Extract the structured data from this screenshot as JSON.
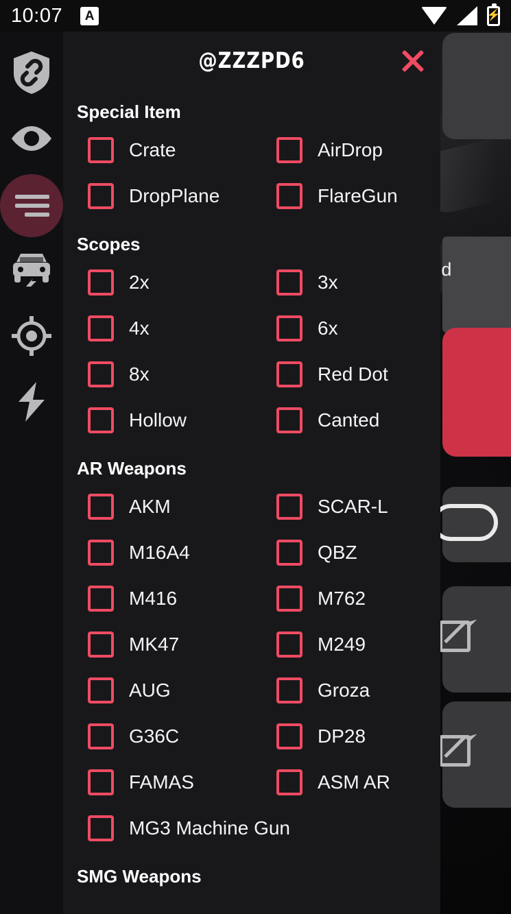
{
  "status_bar": {
    "time": "10:07",
    "app_badge": "A",
    "icons": [
      "wifi-icon",
      "signal-icon",
      "battery-charging-icon"
    ]
  },
  "background_app": {
    "partial_label": "nd",
    "icons": [
      "toggle-switch",
      "external-link-icon",
      "external-link-icon"
    ],
    "accent_color": "#cd3247"
  },
  "sidebar": {
    "items": [
      {
        "icon": "shield-link-icon",
        "active": false
      },
      {
        "icon": "eye-icon",
        "active": false
      },
      {
        "icon": "menu-lines-icon",
        "active": true
      },
      {
        "icon": "car-boost-icon",
        "active": false
      },
      {
        "icon": "crosshair-target-icon",
        "active": false
      },
      {
        "icon": "lightning-bolt-icon",
        "active": false
      }
    ],
    "active_bg_color": "#5b2231"
  },
  "drawer": {
    "title": "@ZZZPD6",
    "close_icon": "close-x-icon",
    "accent_color": "#ef4b62",
    "background_color": "#18181b",
    "sections": [
      {
        "id": "special-item",
        "title": "Special Item",
        "options": [
          {
            "label": "Crate",
            "checked": false
          },
          {
            "label": "AirDrop",
            "checked": false
          },
          {
            "label": "DropPlane",
            "checked": false
          },
          {
            "label": "FlareGun",
            "checked": false
          }
        ]
      },
      {
        "id": "scopes",
        "title": "Scopes",
        "options": [
          {
            "label": "2x",
            "checked": false
          },
          {
            "label": "3x",
            "checked": false
          },
          {
            "label": "4x",
            "checked": false
          },
          {
            "label": "6x",
            "checked": false
          },
          {
            "label": "8x",
            "checked": false
          },
          {
            "label": "Red Dot",
            "checked": false
          },
          {
            "label": "Hollow",
            "checked": false
          },
          {
            "label": "Canted",
            "checked": false
          }
        ]
      },
      {
        "id": "ar-weapons",
        "title": "AR Weapons",
        "options": [
          {
            "label": "AKM",
            "checked": false
          },
          {
            "label": "SCAR-L",
            "checked": false
          },
          {
            "label": "M16A4",
            "checked": false
          },
          {
            "label": "QBZ",
            "checked": false
          },
          {
            "label": "M416",
            "checked": false
          },
          {
            "label": "M762",
            "checked": false
          },
          {
            "label": "MK47",
            "checked": false
          },
          {
            "label": "M249",
            "checked": false
          },
          {
            "label": "AUG",
            "checked": false
          },
          {
            "label": "Groza",
            "checked": false
          },
          {
            "label": "G36C",
            "checked": false
          },
          {
            "label": "DP28",
            "checked": false
          },
          {
            "label": "FAMAS",
            "checked": false
          },
          {
            "label": "ASM AR",
            "checked": false
          },
          {
            "label": "MG3 Machine Gun",
            "checked": false,
            "full_width": true
          }
        ]
      },
      {
        "id": "smg-weapons",
        "title": "SMG Weapons",
        "options": []
      }
    ]
  }
}
